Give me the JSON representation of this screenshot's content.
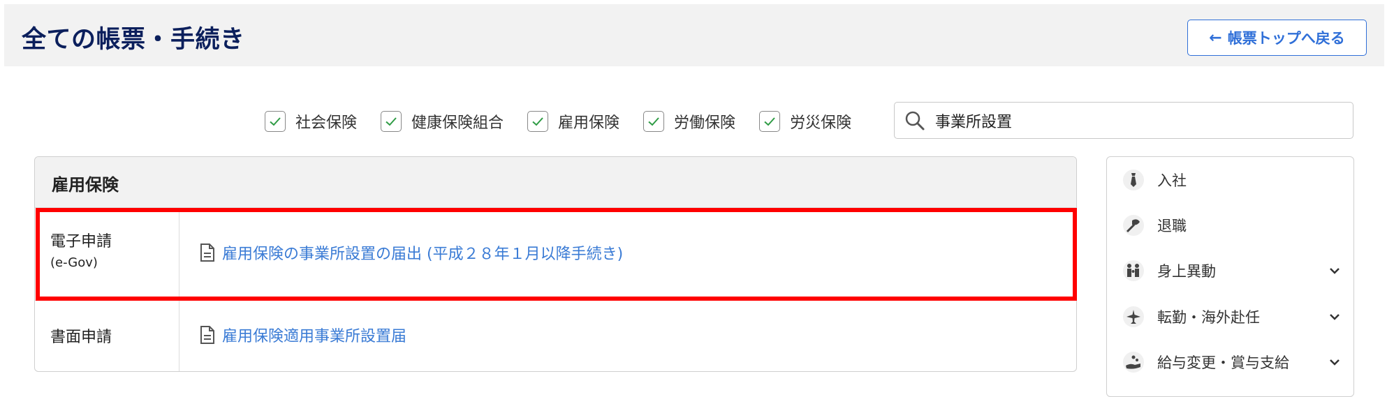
{
  "header": {
    "title": "全ての帳票・手続き",
    "back_arrow": "←",
    "back_label": "帳票トップへ戻る"
  },
  "filters": [
    {
      "label": "社会保険",
      "checked": true
    },
    {
      "label": "健康保険組合",
      "checked": true
    },
    {
      "label": "雇用保険",
      "checked": true
    },
    {
      "label": "労働保険",
      "checked": true
    },
    {
      "label": "労災保険",
      "checked": true
    }
  ],
  "search": {
    "value": "事業所設置",
    "icon": "search-icon"
  },
  "panel": {
    "title": "雇用保険",
    "rows": [
      {
        "type": "電子申請",
        "type_sub": "(e-Gov)",
        "link": "雇用保険の事業所設置の届出 (平成２８年１月以降手続き)",
        "highlighted": true
      },
      {
        "type": "書面申請",
        "type_sub": "",
        "link": "雇用保険適用事業所設置届",
        "highlighted": false
      }
    ]
  },
  "sidebar": {
    "items": [
      {
        "label": "入社",
        "icon": "necktie-icon",
        "expandable": false
      },
      {
        "label": "退職",
        "icon": "bouquet-icon",
        "expandable": false
      },
      {
        "label": "身上異動",
        "icon": "family-icon",
        "expandable": true
      },
      {
        "label": "転勤・海外赴任",
        "icon": "airplane-icon",
        "expandable": true
      },
      {
        "label": "給与変更・賞与支給",
        "icon": "money-hand-icon",
        "expandable": true
      }
    ]
  },
  "colors": {
    "title": "#0b1f5c",
    "link": "#3a7bd5",
    "highlight": "#ff0000",
    "check": "#2e9b44",
    "button": "#2f6fd8"
  }
}
